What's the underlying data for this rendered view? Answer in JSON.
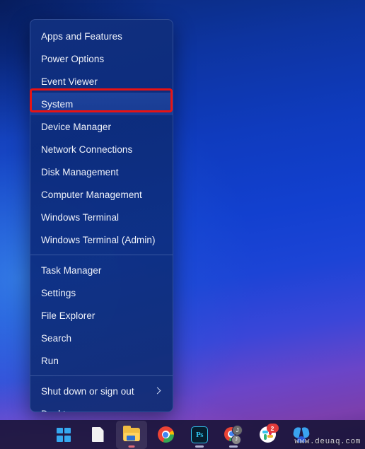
{
  "desktop": {
    "wallpaper_name": "windows-11-bloom-wallpaper",
    "colors": {
      "wallpaper_top": "#0b2a7a",
      "wallpaper_mid": "#1240cf",
      "wallpaper_bottom": "#5a2d88",
      "taskbar_bg": "#1c163c",
      "menu_bg": "#11307e",
      "menu_text": "#f0f3fb",
      "highlight_red": "#e81313",
      "selected_item_bg": "#2a54b2"
    }
  },
  "winx_menu": {
    "name": "Windows Power User (Win+X) menu",
    "selected_item": "System",
    "groups": [
      {
        "items": [
          {
            "label": "Apps and Features",
            "has_submenu": false
          },
          {
            "label": "Power Options",
            "has_submenu": false
          },
          {
            "label": "Event Viewer",
            "has_submenu": false
          },
          {
            "label": "System",
            "has_submenu": false
          },
          {
            "label": "Device Manager",
            "has_submenu": false
          },
          {
            "label": "Network Connections",
            "has_submenu": false
          },
          {
            "label": "Disk Management",
            "has_submenu": false
          },
          {
            "label": "Computer Management",
            "has_submenu": false
          },
          {
            "label": "Windows Terminal",
            "has_submenu": false
          },
          {
            "label": "Windows Terminal (Admin)",
            "has_submenu": false
          }
        ]
      },
      {
        "items": [
          {
            "label": "Task Manager",
            "has_submenu": false
          },
          {
            "label": "Settings",
            "has_submenu": false
          },
          {
            "label": "File Explorer",
            "has_submenu": false
          },
          {
            "label": "Search",
            "has_submenu": false
          },
          {
            "label": "Run",
            "has_submenu": false
          }
        ]
      },
      {
        "items": [
          {
            "label": "Shut down or sign out",
            "has_submenu": true
          },
          {
            "label": "Desktop",
            "has_submenu": false
          }
        ]
      }
    ]
  },
  "taskbar": {
    "items": [
      {
        "name": "start-button",
        "icon": "windows-logo-icon",
        "label": "Start",
        "active": false,
        "running": false,
        "badge": null
      },
      {
        "name": "taskbar-document-app",
        "icon": "document-icon",
        "label": "Document",
        "active": false,
        "running": false,
        "badge": null
      },
      {
        "name": "taskbar-file-explorer",
        "icon": "folder-icon",
        "label": "File Explorer",
        "active": true,
        "running": true,
        "badge": null
      },
      {
        "name": "taskbar-chrome",
        "icon": "chrome-icon",
        "label": "Google Chrome",
        "active": false,
        "running": false,
        "badge": null
      },
      {
        "name": "taskbar-photoshop",
        "icon": "photoshop-icon",
        "label": "Adobe Photoshop",
        "icon_text": "Ps",
        "active": false,
        "running": true,
        "badge": null
      },
      {
        "name": "taskbar-chrome-profile",
        "icon": "chrome-profile-icon",
        "label": "Chrome Profile",
        "profile_initial": "J",
        "active": false,
        "running": true,
        "badge": null
      },
      {
        "name": "taskbar-slack",
        "icon": "slack-icon",
        "label": "Slack",
        "active": false,
        "running": false,
        "badge": "2"
      },
      {
        "name": "taskbar-blue-app",
        "icon": "blue-wings-app-icon",
        "label": "App",
        "active": false,
        "running": false,
        "badge": null
      }
    ]
  },
  "watermark": {
    "text": "www.deuaq.com"
  }
}
